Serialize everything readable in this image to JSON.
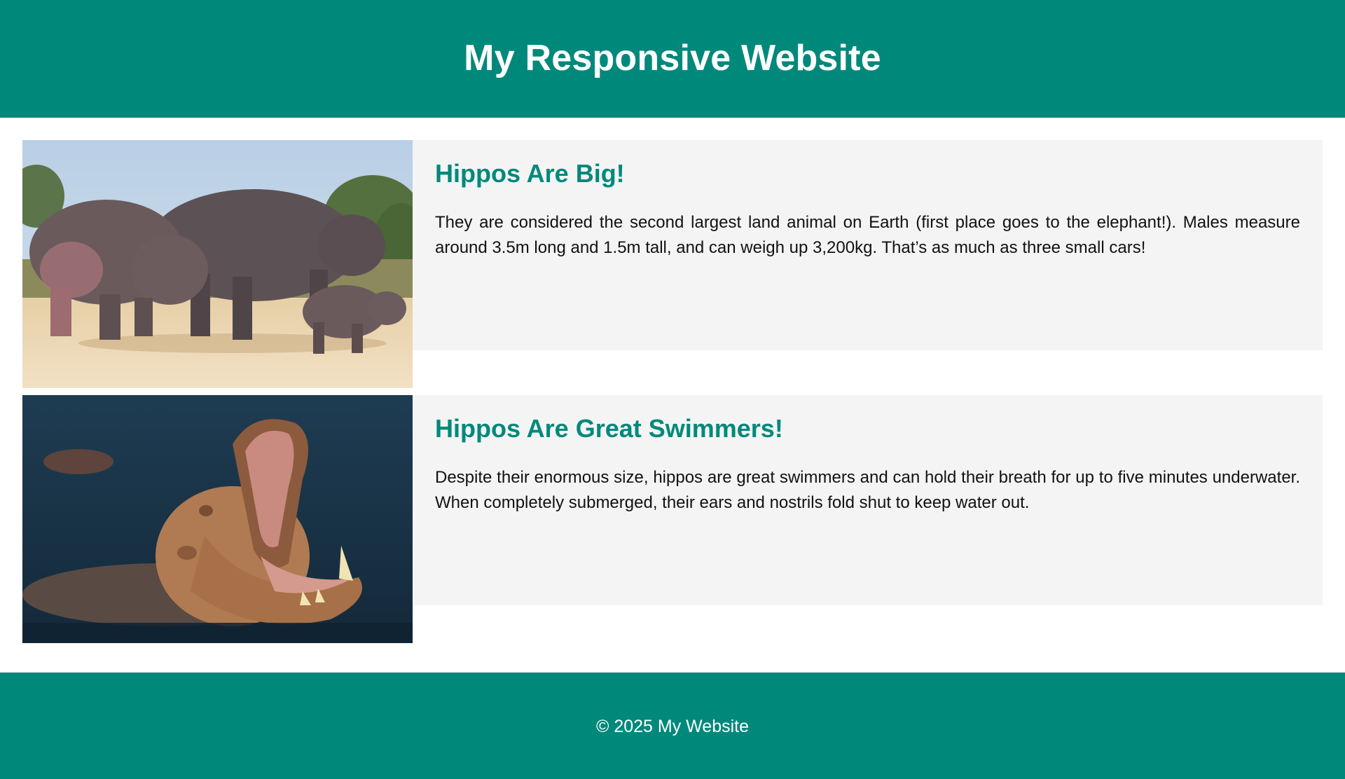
{
  "header": {
    "title": "My Responsive Website"
  },
  "cards": [
    {
      "title": "Hippos Are Big!",
      "text": "They are considered the second largest land animal on Earth (first place goes to the elephant!). Males measure around 3.5m long and 1.5m tall, and can weigh up 3,200kg. That’s as much as three small cars!",
      "image_icon": "hippo-family-photo"
    },
    {
      "title": "Hippos Are Great Swimmers!",
      "text": "Despite their enormous size, hippos are great swimmers and can hold their breath for up to five minutes underwater. When completely submerged, their ears and nostrils fold shut to keep water out.",
      "image_icon": "yawning-hippo-photo"
    }
  ],
  "footer": {
    "text": "© 2025 My Website"
  },
  "colors": {
    "brand": "#00897b",
    "card_bg": "#f4f4f4",
    "heading": "#00897b"
  }
}
